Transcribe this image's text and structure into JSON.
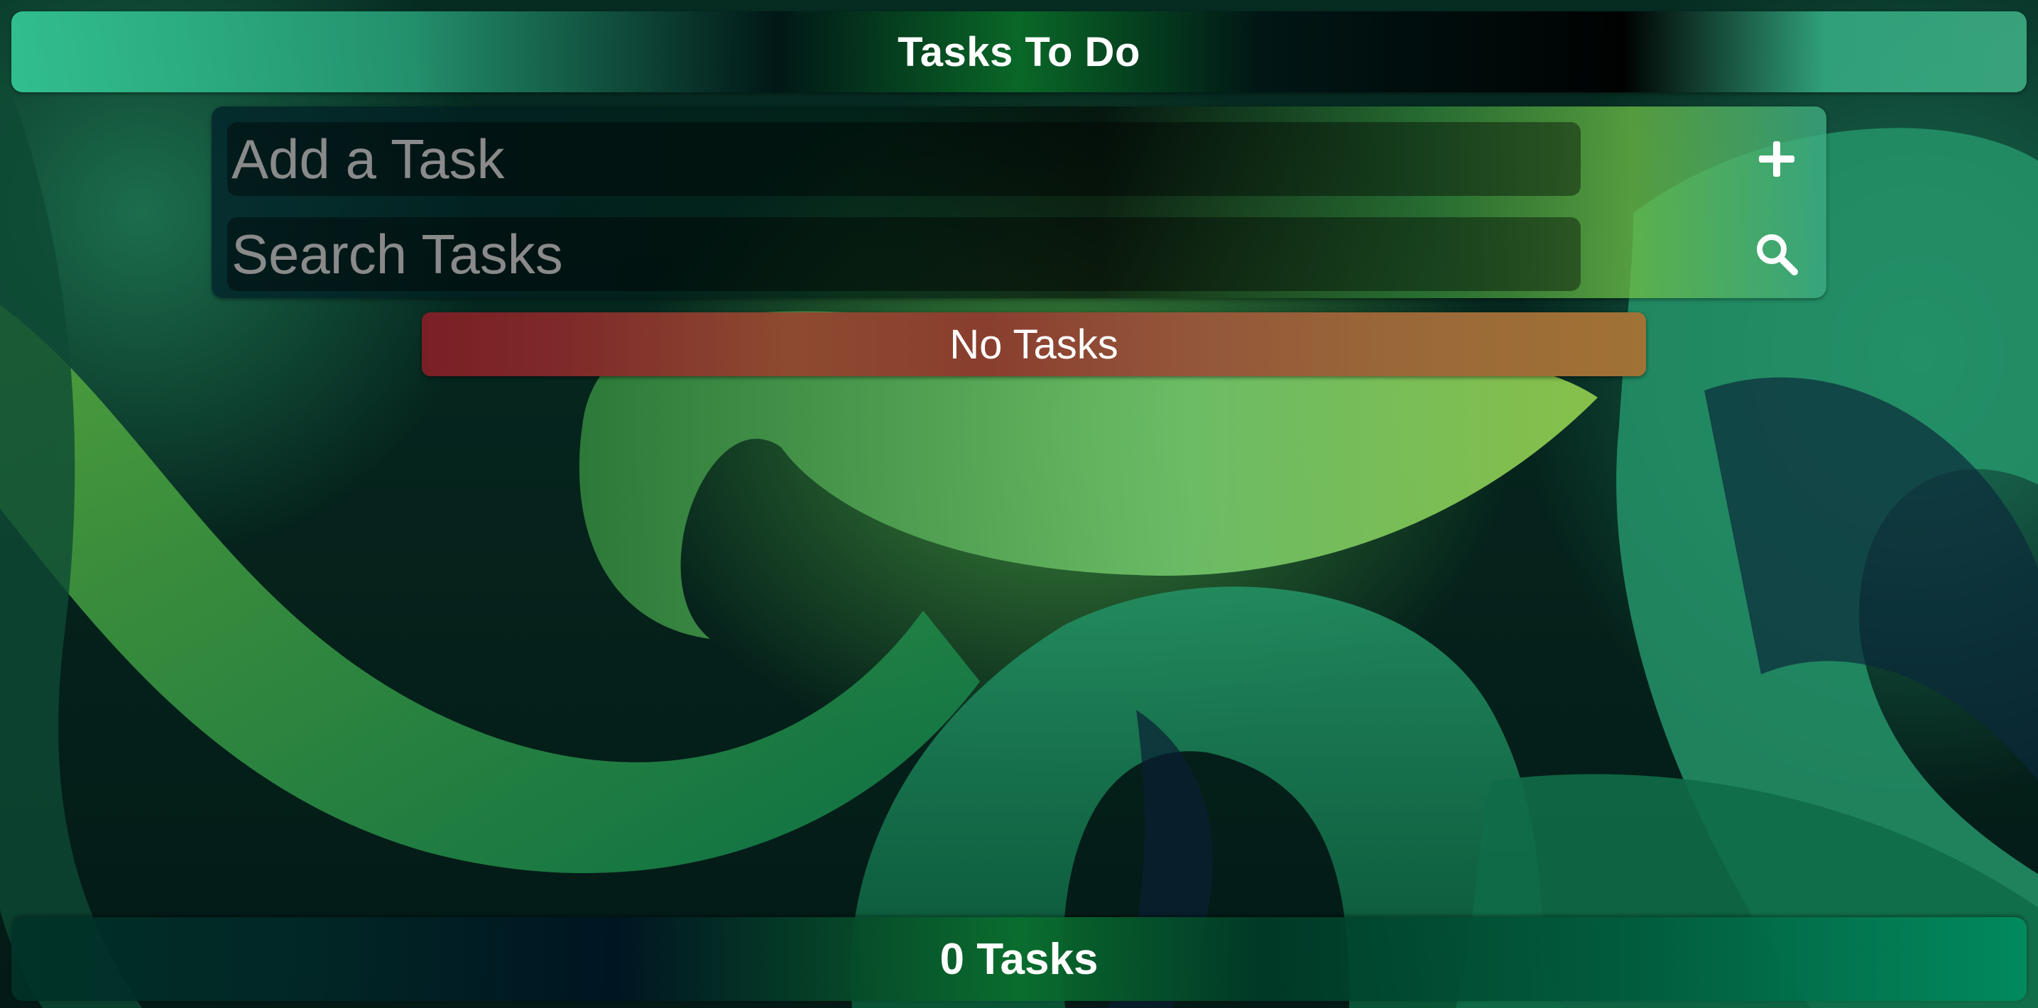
{
  "app": {
    "title": "Tasks To Do"
  },
  "add_task": {
    "placeholder": "Add a Task",
    "value": "",
    "button_icon": "plus-icon"
  },
  "search": {
    "placeholder": "Search Tasks",
    "value": "",
    "button_icon": "search-icon"
  },
  "status": {
    "message": "No Tasks"
  },
  "footer": {
    "task_count": "0 Tasks"
  },
  "colors": {
    "accent_green": "#34C896",
    "banner_red": "#7A1F26",
    "banner_orange": "#A17236",
    "text_white": "#FFFFFF",
    "placeholder_gray": "#8A8A8A"
  }
}
